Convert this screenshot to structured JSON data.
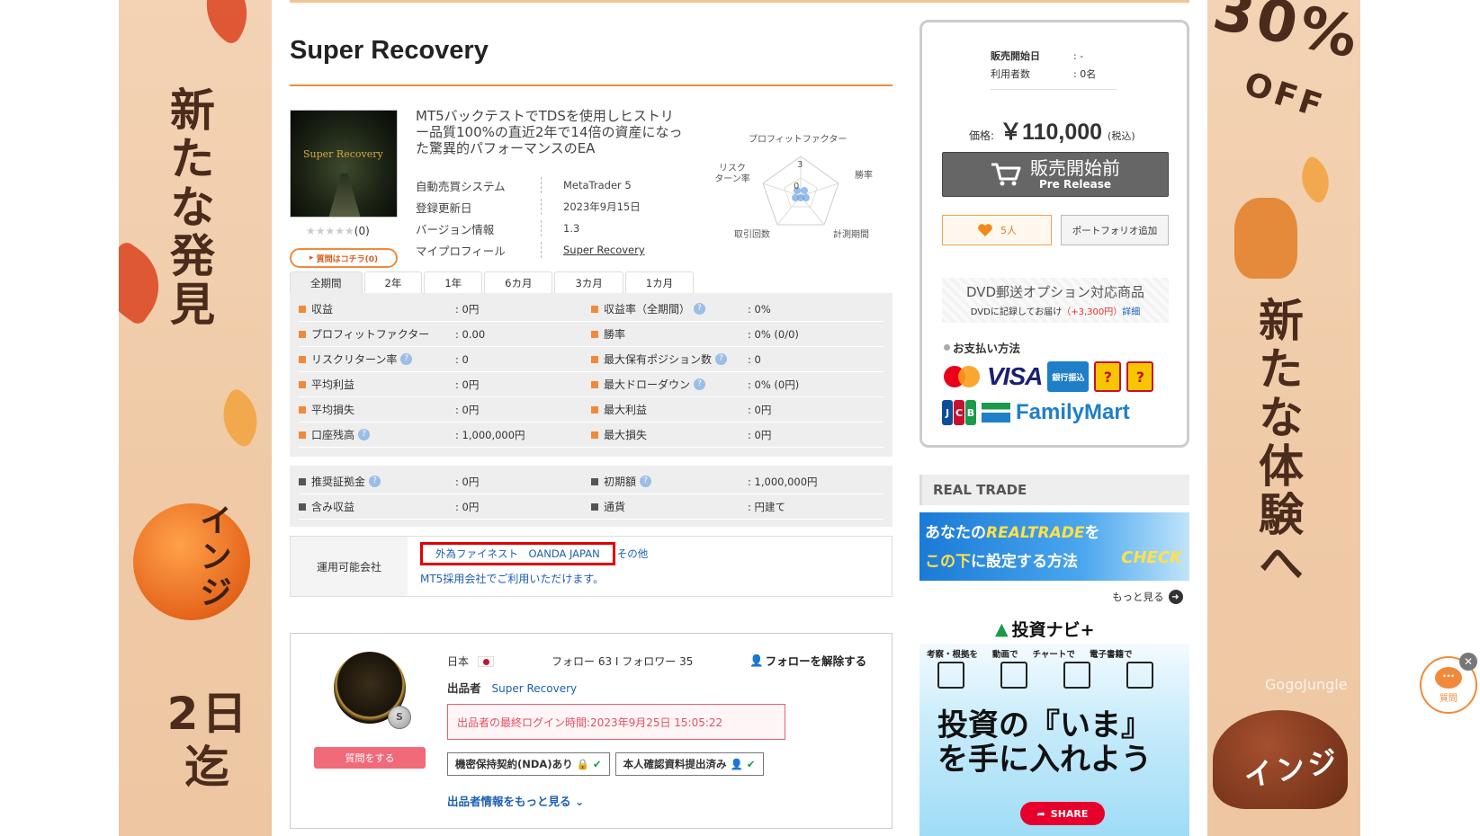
{
  "banners": {
    "left_main": "新たな発見",
    "left_sub": "インジ",
    "left_bottom": "2日迄",
    "right_top": "30%",
    "right_off": "OFF",
    "right_main": "新たな体験へ",
    "right_brand": "GogoJungle",
    "right_bottom": "インジ"
  },
  "product": {
    "title": "Super Recovery",
    "thumb_text": "Super Recovery",
    "rating_stars": "★★★★★",
    "rating_count": "(0)",
    "ask_button": "質問はコチラ(0)",
    "description": "MT5バックテストでTDSを使用しヒストリー品質100%の直近2年で14倍の資産になった驚異的パフォーマンスのEA",
    "info": [
      {
        "key": "自動売買システム",
        "value": "MetaTrader 5"
      },
      {
        "key": "登録更新日",
        "value": "2023年9月15日"
      },
      {
        "key": "バージョン情報",
        "value": "1.3"
      },
      {
        "key": "マイプロフィール",
        "value": "Super Recovery"
      }
    ]
  },
  "radar": {
    "labels": {
      "top": "プロフィットファクター",
      "left": "リスク\nターン率",
      "right": "勝率",
      "bottom_left": "取引回数",
      "bottom_right": "計測期間"
    },
    "tick_3": "3",
    "tick_0": "0"
  },
  "tabs": [
    "全期間",
    "2年",
    "1年",
    "6カ月",
    "3カ月",
    "1カ月"
  ],
  "stats": [
    [
      {
        "label": "収益",
        "value": ": 0円",
        "help": false
      },
      {
        "label": "収益率（全期間）",
        "value": ": 0%",
        "help": true
      }
    ],
    [
      {
        "label": "プロフィットファクター",
        "value": ": 0.00",
        "help": false
      },
      {
        "label": "勝率",
        "value": ": 0% (0/0)",
        "help": false
      }
    ],
    [
      {
        "label": "リスクリターン率",
        "value": ": 0",
        "help": true
      },
      {
        "label": "最大保有ポジション数",
        "value": ": 0",
        "help": true
      }
    ],
    [
      {
        "label": "平均利益",
        "value": ": 0円",
        "help": false
      },
      {
        "label": "最大ドローダウン",
        "value": ": 0% (0円)",
        "help": true
      }
    ],
    [
      {
        "label": "平均損失",
        "value": ": 0円",
        "help": false
      },
      {
        "label": "最大利益",
        "value": ": 0円",
        "help": false
      }
    ],
    [
      {
        "label": "口座残高",
        "value": ": 1,000,000円",
        "help": true
      },
      {
        "label": "最大損失",
        "value": ": 0円",
        "help": false
      }
    ]
  ],
  "stats2": [
    [
      {
        "label": "推奨証拠金",
        "value": ": 0円",
        "help": true
      },
      {
        "label": "初期額",
        "value": ": 1,000,000円",
        "help": true
      }
    ],
    [
      {
        "label": "含み収益",
        "value": ": 0円",
        "help": false
      },
      {
        "label": "通貨",
        "value": ": 円建て",
        "help": false
      }
    ]
  ],
  "company": {
    "label": "運用可能会社",
    "links": "外為ファイネスト　OANDA JAPAN",
    "other": "その他",
    "note": "MT5採用会社でご利用いただけます。"
  },
  "seller": {
    "country": "日本",
    "follow": "フォロー 63 I フォロワー 35",
    "unfollow": "フォローを解除する",
    "seller_label": "出品者",
    "seller_name": "Super Recovery",
    "last_login": "出品者の最終ログイン時間:2023年9月25日 15:05:22",
    "badge_nda": "機密保持契約(NDA)あり",
    "badge_id": "本人確認資料提出済み",
    "more": "出品者情報をもっと見る",
    "ask": "質問をする",
    "avatar_badge": "S"
  },
  "purchase": {
    "sale_start_label": "販売開始日",
    "sale_start_value": ": -",
    "users_label": "利用者数",
    "users_value": ": 0名",
    "price_label": "価格:",
    "price": "￥110,000",
    "tax": "(税込)",
    "pre_release_jp": "販売開始前",
    "pre_release_en": "Pre Release",
    "likes": "5人",
    "portfolio": "ポートフォリオ追加",
    "dvd_title": "DVD郵送オプション対応商品",
    "dvd_desc": "DVDに記録してお届け",
    "dvd_price": "（+3,300円）",
    "dvd_detail": "詳細",
    "payment_title": "お支払い方法",
    "visa": "VISA",
    "bank": "銀行振込",
    "familymart": "FamilyMart"
  },
  "realtrade": {
    "heading": "REAL TRADE",
    "banner_l1a": "あなたの",
    "banner_l1b": "REALTRADE",
    "banner_l1c": "を",
    "banner_l2a": "この下",
    "banner_l2b": "に設定する方法",
    "banner_check": "CHECK",
    "more": "もっと見る"
  },
  "navi": {
    "title": "投資ナビ+",
    "tags": [
      "考察・根拠を",
      "動画で",
      "チャートで",
      "電子書籍で"
    ],
    "headline1": "投資の『いま』",
    "headline2": "を手に入れよう",
    "share": "SHARE"
  },
  "chat": {
    "label": "質問"
  }
}
